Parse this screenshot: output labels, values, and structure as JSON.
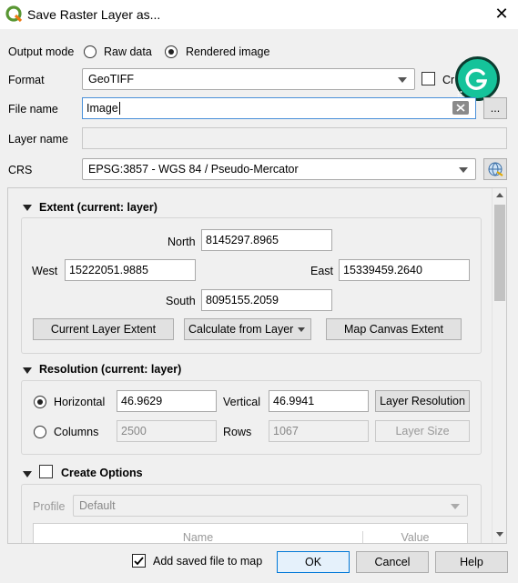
{
  "window": {
    "title": "Save Raster Layer as...",
    "close_icon": "✕"
  },
  "output_mode": {
    "label": "Output mode",
    "raw": "Raw data",
    "rendered": "Rendered image"
  },
  "format": {
    "label": "Format",
    "value": "GeoTIFF",
    "cr_label": "Cr"
  },
  "file_name": {
    "label": "File name",
    "value": "Image",
    "browse": "..."
  },
  "layer_name": {
    "label": "Layer name",
    "value": ""
  },
  "crs": {
    "label": "CRS",
    "value": "EPSG:3857 - WGS 84 / Pseudo-Mercator"
  },
  "extent": {
    "title": "Extent (current: layer)",
    "north_label": "North",
    "north": "8145297.8965",
    "west_label": "West",
    "west": "15222051.9885",
    "east_label": "East",
    "east": "15339459.2640",
    "south_label": "South",
    "south": "8095155.2059",
    "btn_current": "Current Layer Extent",
    "btn_calc": "Calculate from Layer",
    "btn_canvas": "Map Canvas Extent"
  },
  "resolution": {
    "title": "Resolution (current: layer)",
    "horizontal_label": "Horizontal",
    "horizontal": "46.9629",
    "vertical_label": "Vertical",
    "vertical": "46.9941",
    "btn_layer_res": "Layer Resolution",
    "columns_label": "Columns",
    "columns": "2500",
    "rows_label": "Rows",
    "rows": "1067",
    "btn_layer_size": "Layer Size"
  },
  "create_options": {
    "title": "Create Options",
    "profile_label": "Profile",
    "profile_value": "Default",
    "col_name": "Name",
    "col_value": "Value"
  },
  "footer": {
    "add_to_map": "Add saved file to map",
    "ok": "OK",
    "cancel": "Cancel",
    "help": "Help"
  }
}
